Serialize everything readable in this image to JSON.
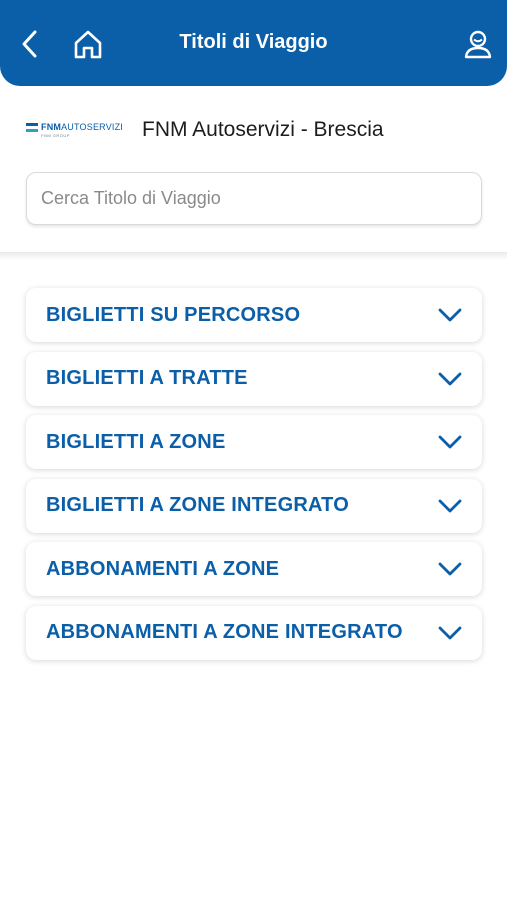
{
  "header": {
    "title": "Titoli di Viaggio",
    "back_icon": "chevron-left-icon",
    "home_icon": "home-icon",
    "profile_icon": "user-icon",
    "background_color": "#0b5ea8"
  },
  "operator": {
    "logo_text_bold": "FNM",
    "logo_text": "AUTOSERVIZI",
    "logo_subtext": "FNM GROUP",
    "name": "FNM Autoservizi - Brescia"
  },
  "search": {
    "placeholder": "Cerca Titolo di Viaggio",
    "value": ""
  },
  "categories": [
    {
      "label": "BIGLIETTI SU PERCORSO"
    },
    {
      "label": "BIGLIETTI A TRATTE"
    },
    {
      "label": "BIGLIETTI A ZONE"
    },
    {
      "label": "BIGLIETTI A ZONE INTEGRATO"
    },
    {
      "label": "ABBONAMENTI A ZONE"
    },
    {
      "label": "ABBONAMENTI A ZONE INTEGRATO"
    }
  ],
  "colors": {
    "accent": "#0b5ea8",
    "text": "#1d1d1d"
  }
}
